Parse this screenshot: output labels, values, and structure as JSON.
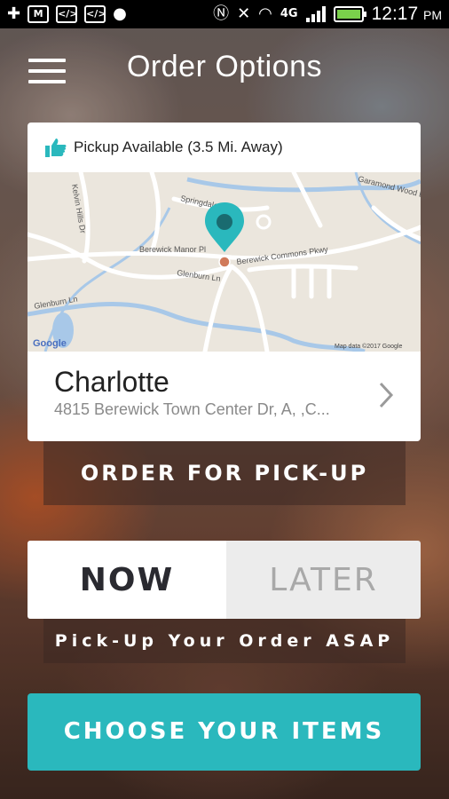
{
  "status_bar": {
    "time": "12:17",
    "ampm": "PM",
    "network": "4G"
  },
  "header": {
    "title": "Order Options"
  },
  "pickup": {
    "availability_text": "Pickup Available (3.5 Mi. Away)"
  },
  "map": {
    "streets": [
      "Kelvin Hills Dr",
      "Berewick Manor Pl",
      "Glenburn Ln",
      "Berewick Commons Pkwy",
      "Garamond Wood Dr",
      "Springdale"
    ],
    "google_label": "Google",
    "copyright": "Map data ©2017 Google"
  },
  "location": {
    "name": "Charlotte",
    "address": "4815 Berewick Town Center Dr, A, ,C..."
  },
  "buttons": {
    "order_pickup": "ORDER FOR PICK-UP",
    "choose_items": "CHOOSE YOUR ITEMS"
  },
  "timing": {
    "now": "NOW",
    "later": "LATER",
    "selected": "NOW",
    "caption": "Pick-Up Your Order ASAP"
  },
  "colors": {
    "accent": "#2ab8bd",
    "status_bar": "#000000",
    "battery": "#7ad14b"
  }
}
